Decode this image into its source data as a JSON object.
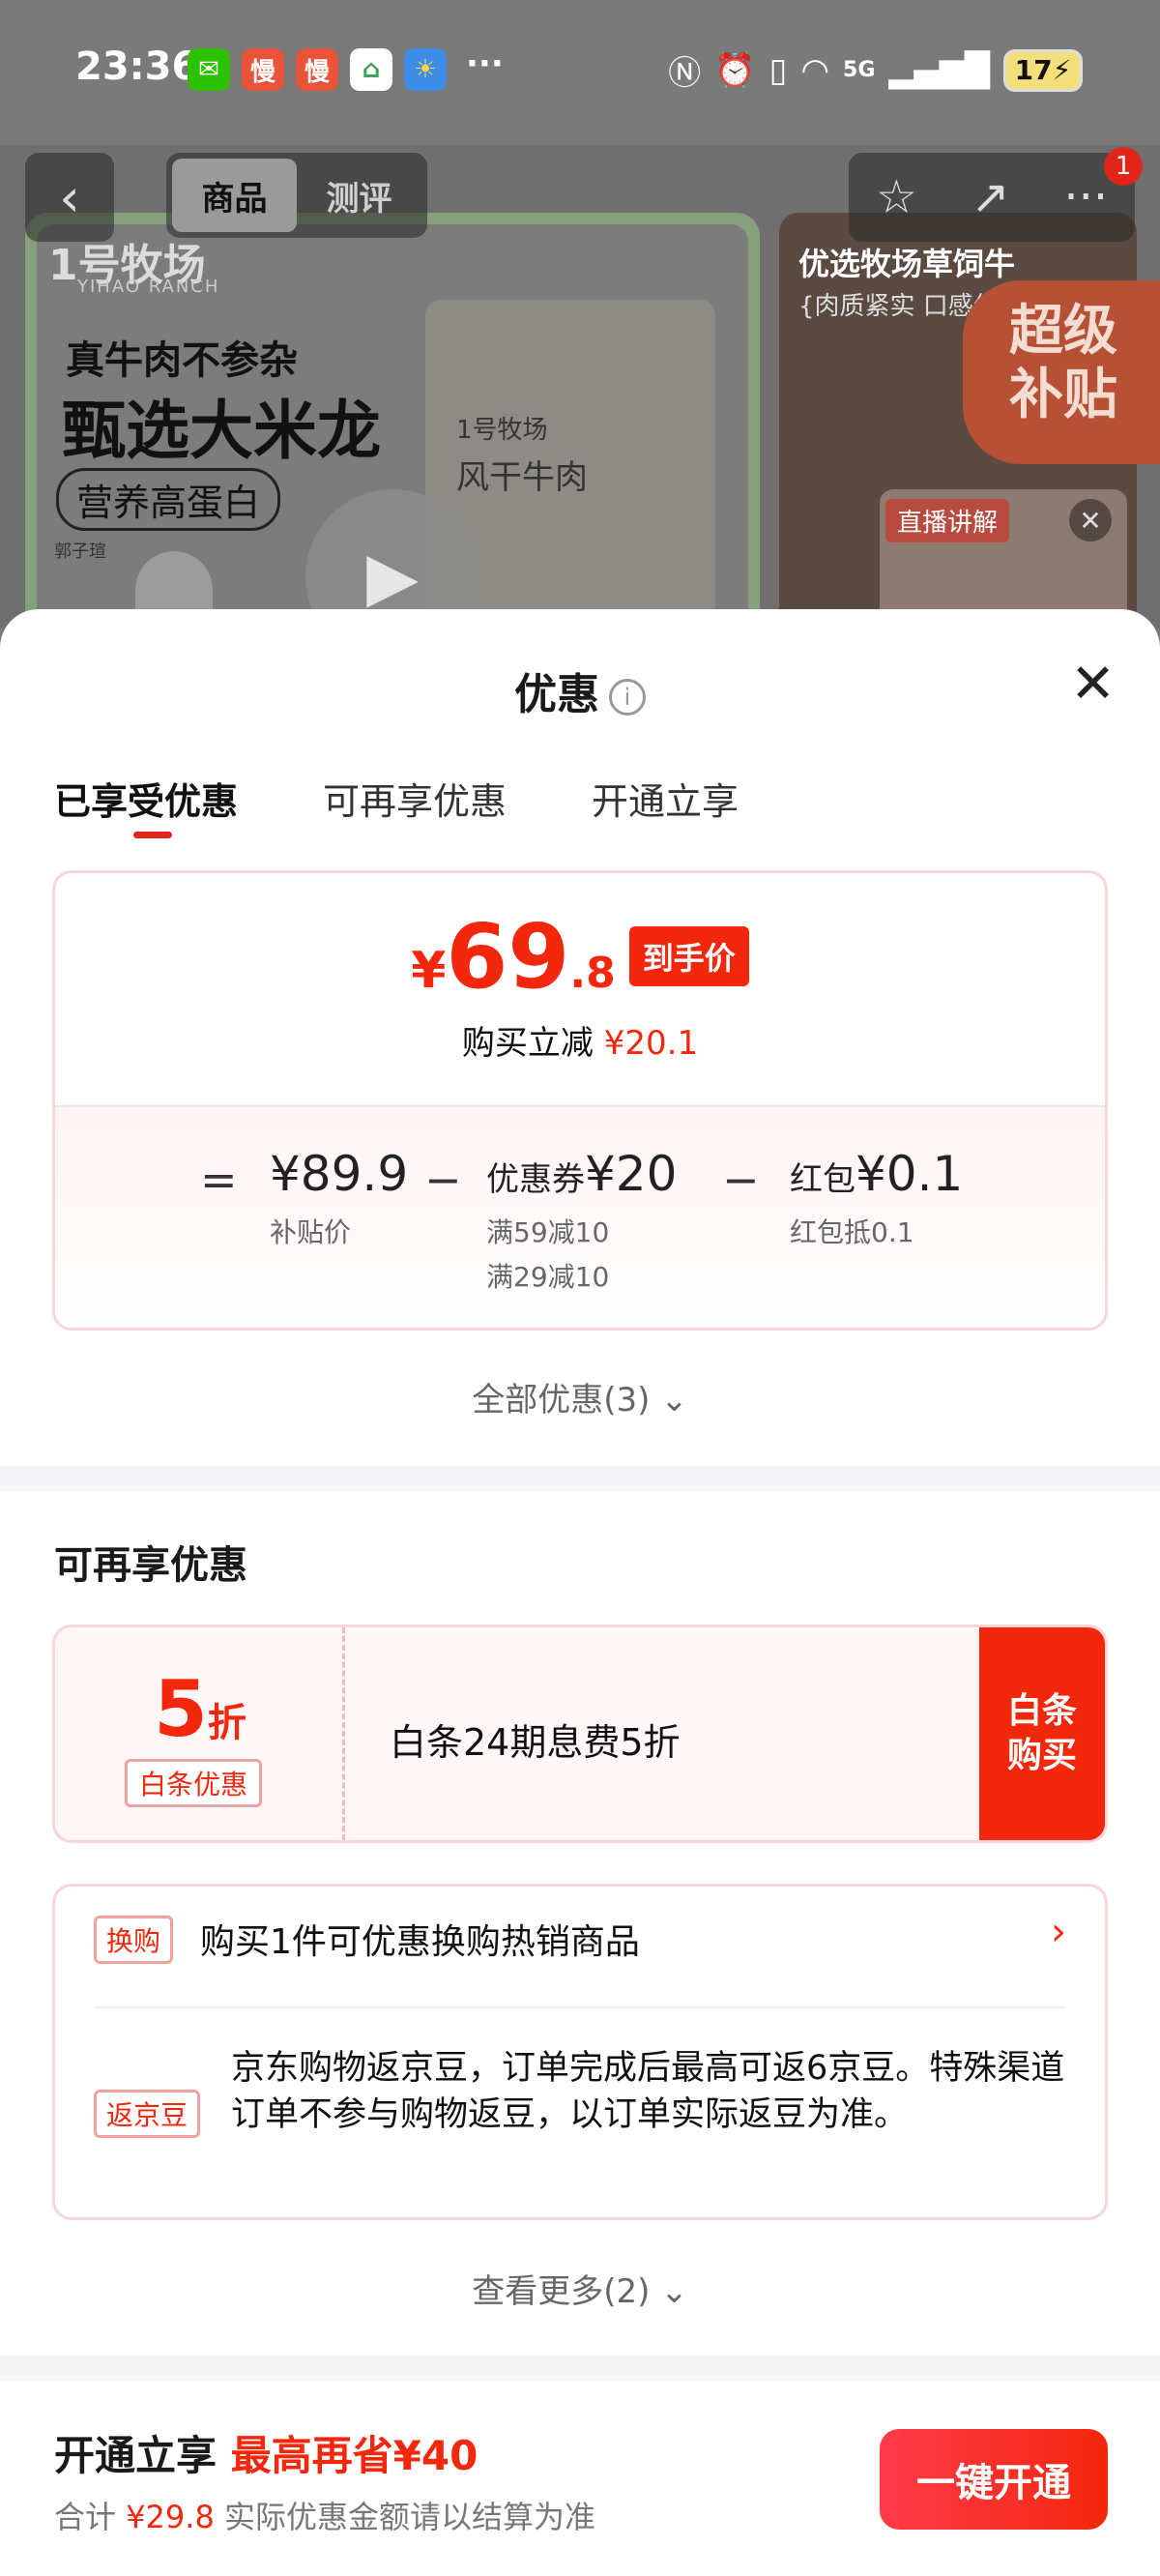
{
  "status_bar": {
    "time": "23:36",
    "apps": [
      {
        "icon": "wechat-icon",
        "glyph": "✉",
        "color": "#2dc100"
      },
      {
        "icon": "app-man-icon",
        "glyph": "慢",
        "color": "#e9533a"
      },
      {
        "icon": "app-man2-icon",
        "glyph": "慢",
        "color": "#e9533a"
      },
      {
        "icon": "home-app-icon",
        "glyph": "⌂",
        "color": "#ffffff"
      },
      {
        "icon": "weather-icon",
        "glyph": "☀",
        "color": "#3b8de8"
      }
    ],
    "more": "···",
    "signal_label": "5G",
    "battery": "17"
  },
  "product_nav": {
    "back": "‹",
    "tabs": [
      "商品",
      "测评"
    ],
    "badge": "1"
  },
  "product_bg": {
    "brand": "1号牧场",
    "brand_sub": "YIHAO RANCH",
    "promo_line1": "真牛肉不参杂",
    "promo_line2": "甄选大米龙",
    "promo_line3": "营养高蛋白",
    "bag_brand": "1号牧场",
    "bag_name": "风干牛肉",
    "right_title": "优选牧场草饲牛",
    "right_sub": "{肉质紧实 口感偏筋",
    "super_subsidy": "超级补贴",
    "live_tag": "直播讲解"
  },
  "sheet": {
    "title": "优惠",
    "tabs": [
      "已享受优惠",
      "可再享优惠",
      "开通立享"
    ],
    "price": {
      "currency": "¥",
      "integer": "69",
      "decimal": ".8",
      "tag": "到手价",
      "reduce_label": "购买立减",
      "reduce_amount": "¥20.1"
    },
    "calc": {
      "eq": "=",
      "minus": "−",
      "base_value": "¥89.9",
      "base_label": "补贴价",
      "coupon_name": "优惠券",
      "coupon_value": "¥20",
      "coupon_label1": "满59减10",
      "coupon_label2": "满29减10",
      "redpack_name": "红包",
      "redpack_value": "¥0.1",
      "redpack_label": "红包抵0.1"
    },
    "all_discounts": "全部优惠(3)",
    "section_title": "可再享优惠",
    "baitiao": {
      "num": "5",
      "unit": "折",
      "tag": "白条优惠",
      "desc": "白条24期息费5折",
      "button": "白条购买"
    },
    "exchange": {
      "tag": "换购",
      "text": "购买1件可优惠换购热销商品"
    },
    "jingdou": {
      "tag": "返京豆",
      "text": "京东购物返京豆，订单完成后最高可返6京豆。特殊渠道订单不参与购物返豆，以订单实际返豆为准。"
    },
    "see_more": "查看更多(2)",
    "bottom": {
      "title_prefix": "开通立享",
      "title_highlight": "最高再省¥40",
      "sub_prefix": "合计",
      "sub_amount": "¥29.8",
      "sub_suffix": "实际优惠金额请以结算为准",
      "button": "一键开通"
    }
  }
}
